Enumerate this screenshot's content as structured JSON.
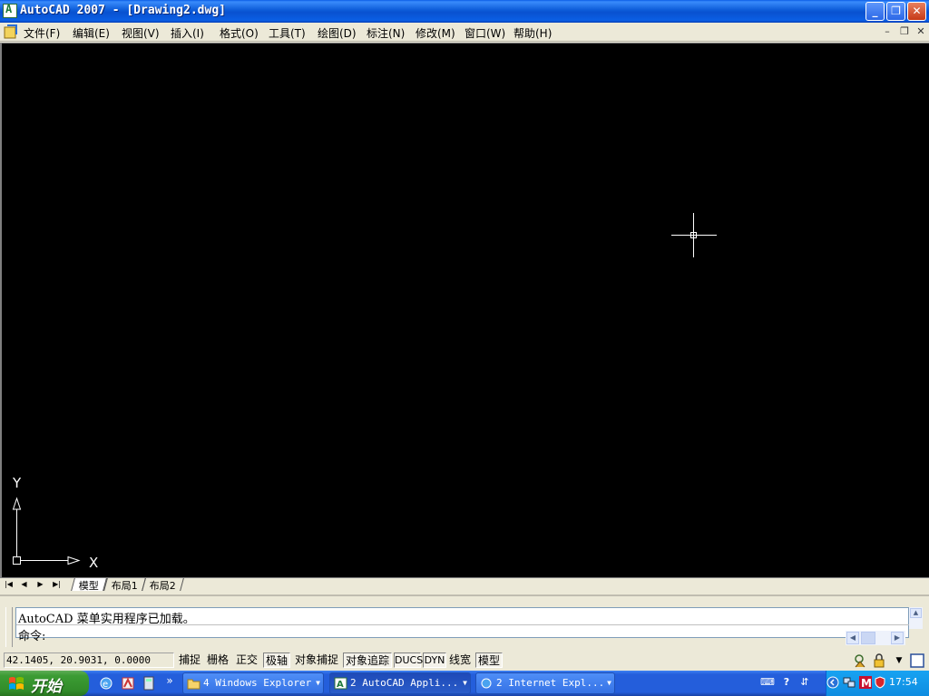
{
  "window": {
    "title": "AutoCAD 2007 - [Drawing2.dwg]",
    "controls": {
      "minimize": "_",
      "restore": "❐",
      "close": "✕"
    }
  },
  "menubar": {
    "items": [
      {
        "label": "文件(F)"
      },
      {
        "label": "编辑(E)"
      },
      {
        "label": "视图(V)"
      },
      {
        "label": "插入(I)"
      },
      {
        "label": "格式(O)"
      },
      {
        "label": "工具(T)"
      },
      {
        "label": "绘图(D)"
      },
      {
        "label": "标注(N)"
      },
      {
        "label": "修改(M)"
      },
      {
        "label": "窗口(W)"
      },
      {
        "label": "帮助(H)"
      }
    ],
    "mdi": {
      "minimize": "–",
      "restore": "❐",
      "close": "✕"
    }
  },
  "canvas": {
    "background": "#000000",
    "ucs": {
      "x_label": "X",
      "y_label": "Y"
    }
  },
  "layout_tabs": [
    {
      "label": "模型",
      "active": true
    },
    {
      "label": "布局1",
      "active": false
    },
    {
      "label": "布局2",
      "active": false
    }
  ],
  "command_window": {
    "history_line": "AutoCAD 菜单实用程序已加载。",
    "prompt": "命令:"
  },
  "statusbar": {
    "coordinates": "42.1405, 20.9031, 0.0000",
    "toggles": [
      {
        "label": "捕捉",
        "on": false
      },
      {
        "label": "栅格",
        "on": false
      },
      {
        "label": "正交",
        "on": false
      },
      {
        "label": "极轴",
        "on": true
      },
      {
        "label": "对象捕捉",
        "on": false
      },
      {
        "label": "对象追踪",
        "on": true
      },
      {
        "label": "DUCS",
        "on": true
      },
      {
        "label": "DYN",
        "on": true
      },
      {
        "label": "线宽",
        "on": false
      },
      {
        "label": "模型",
        "on": true
      }
    ]
  },
  "taskbar": {
    "start_label": "开始",
    "tasks": [
      {
        "label": "4 Windows Explorer",
        "active": false
      },
      {
        "label": "2 AutoCAD Appli...",
        "active": true
      },
      {
        "label": "2 Internet Expl...",
        "active": false
      }
    ],
    "clock": "17:54",
    "chevron": "»"
  }
}
